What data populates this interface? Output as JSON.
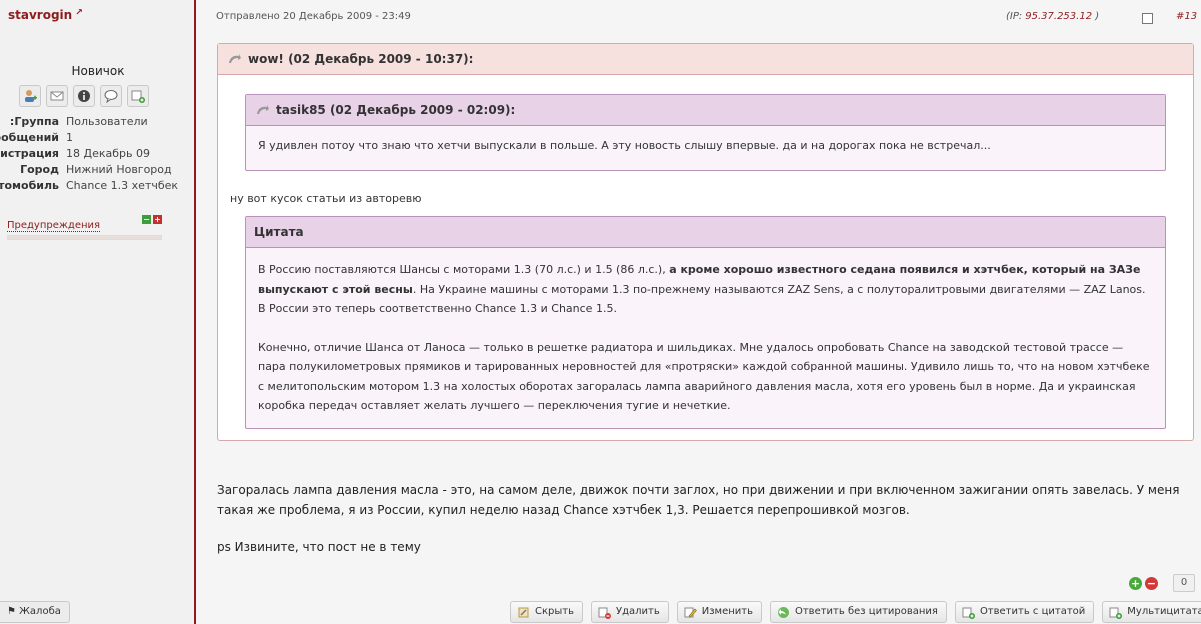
{
  "user": {
    "name": "stavrogin",
    "rank": "Новичок",
    "info": [
      {
        "label": "Группа:",
        "value": "Пользователи"
      },
      {
        "label": "Сообщений:",
        "value": "1"
      },
      {
        "label": "Регистрация:",
        "value": "18 Декабрь 09"
      },
      {
        "label": "Город",
        "value": "Нижний Новгород"
      },
      {
        "label": "Автомобиль:",
        "value": "Chance 1.3 хетчбек"
      }
    ],
    "warnings_label": "Предупреждения",
    "report_label": "Жалоба"
  },
  "post": {
    "posted": "Отправлено 20 Декабрь 2009 - 23:49",
    "ip_prefix": "(IP: ",
    "ip": "95.37.253.12",
    "ip_suffix": " )",
    "number": "#13",
    "quote_outer_title": "wow! (02 Декабрь 2009 - 10:37):",
    "quote_inner_title": "tasik85 (02 Декабрь 2009 - 02:09):",
    "quote_inner_text": "Я удивлен потоу что знаю что хетчи выпускали в польше. А эту новость слышу впервые. да и на дорогах пока не встречал...",
    "middle_text": "ну вот кусок статьи из авторевю",
    "citation_title": "Цитата",
    "citation_p1_a": "В Россию поставляются Шансы с моторами 1.3 (70 л.с.) и 1.5 (86 л.с.), ",
    "citation_p1_bold": "а кроме хорошо известного седана появился и хэтчбек, который на ЗАЗе выпускают с этой весны",
    "citation_p1_b": ". На Украине машины с моторами 1.3 по-прежнему называются ZAZ Sens, а с полуторалитровыми двигателями — ZAZ Lanos. В России это теперь соответственно Chance 1.3 и Chance 1.5.",
    "citation_p2": "Конечно, отличие Шанса от Ланоса — только в решетке радиатора и шильдиках. Мне удалось опробовать Chance на заводской тестовой трассе — пара полукилометровых прямиков и тарированных неровностей для «протряски» каждой собранной машины. Удивило лишь то, что на новом хэтчбеке с мелитопольским мотором 1.3 на холостых оборотах загоралась лампа аварийного давления масла, хотя его уровень был в норме. Да и украинская коробка передач оставляет желать лучшего — переключения тугие и нечеткие.",
    "reply_text": "Загоралась лампа давления масла - это, на самом деле, движок почти заглох, но при движении и при включенном зажигании опять завелась. У меня такая же проблема, я из России, купил неделю назад Chance хэтчбек 1,3. Решается перепрошивкой мозгов.",
    "ps_text": "ps Извините, что пост не в тему",
    "rating": "0"
  },
  "buttons": {
    "hide": "Скрыть",
    "delete": "Удалить",
    "edit": "Изменить",
    "reply_no_quote": "Ответить без цитирования",
    "reply_quote": "Ответить с цитатой",
    "multiquote": "Мультицитата"
  }
}
